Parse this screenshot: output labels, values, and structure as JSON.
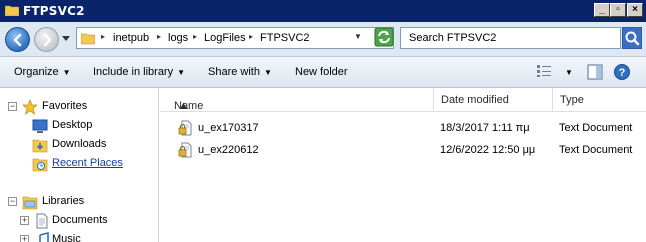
{
  "window": {
    "title": "FTPSVC2"
  },
  "address": {
    "crumbs": [
      "inetpub",
      "logs",
      "LogFiles",
      "FTPSVC2"
    ],
    "sep": "▸"
  },
  "search": {
    "placeholder": "Search FTPSVC2"
  },
  "toolbar": {
    "organize": "Organize",
    "include_in_library": "Include in library",
    "share_with": "Share with",
    "new_folder": "New folder"
  },
  "nav": {
    "favorites": "Favorites",
    "desktop": "Desktop",
    "downloads": "Downloads",
    "recent_places": "Recent Places",
    "libraries": "Libraries",
    "documents": "Documents",
    "music": "Music"
  },
  "columns": {
    "name": "Name",
    "date_modified": "Date modified",
    "type": "Type"
  },
  "files": [
    {
      "name": "u_ex170317",
      "date": "18/3/2017 1:11 πμ",
      "type": "Text Document"
    },
    {
      "name": "u_ex220612",
      "date": "12/6/2022 12:50 μμ",
      "type": "Text Document"
    }
  ],
  "colors": {
    "titlebar": "#0a246a",
    "accent": "#2e6fc0",
    "link": "#1a3e9c"
  }
}
